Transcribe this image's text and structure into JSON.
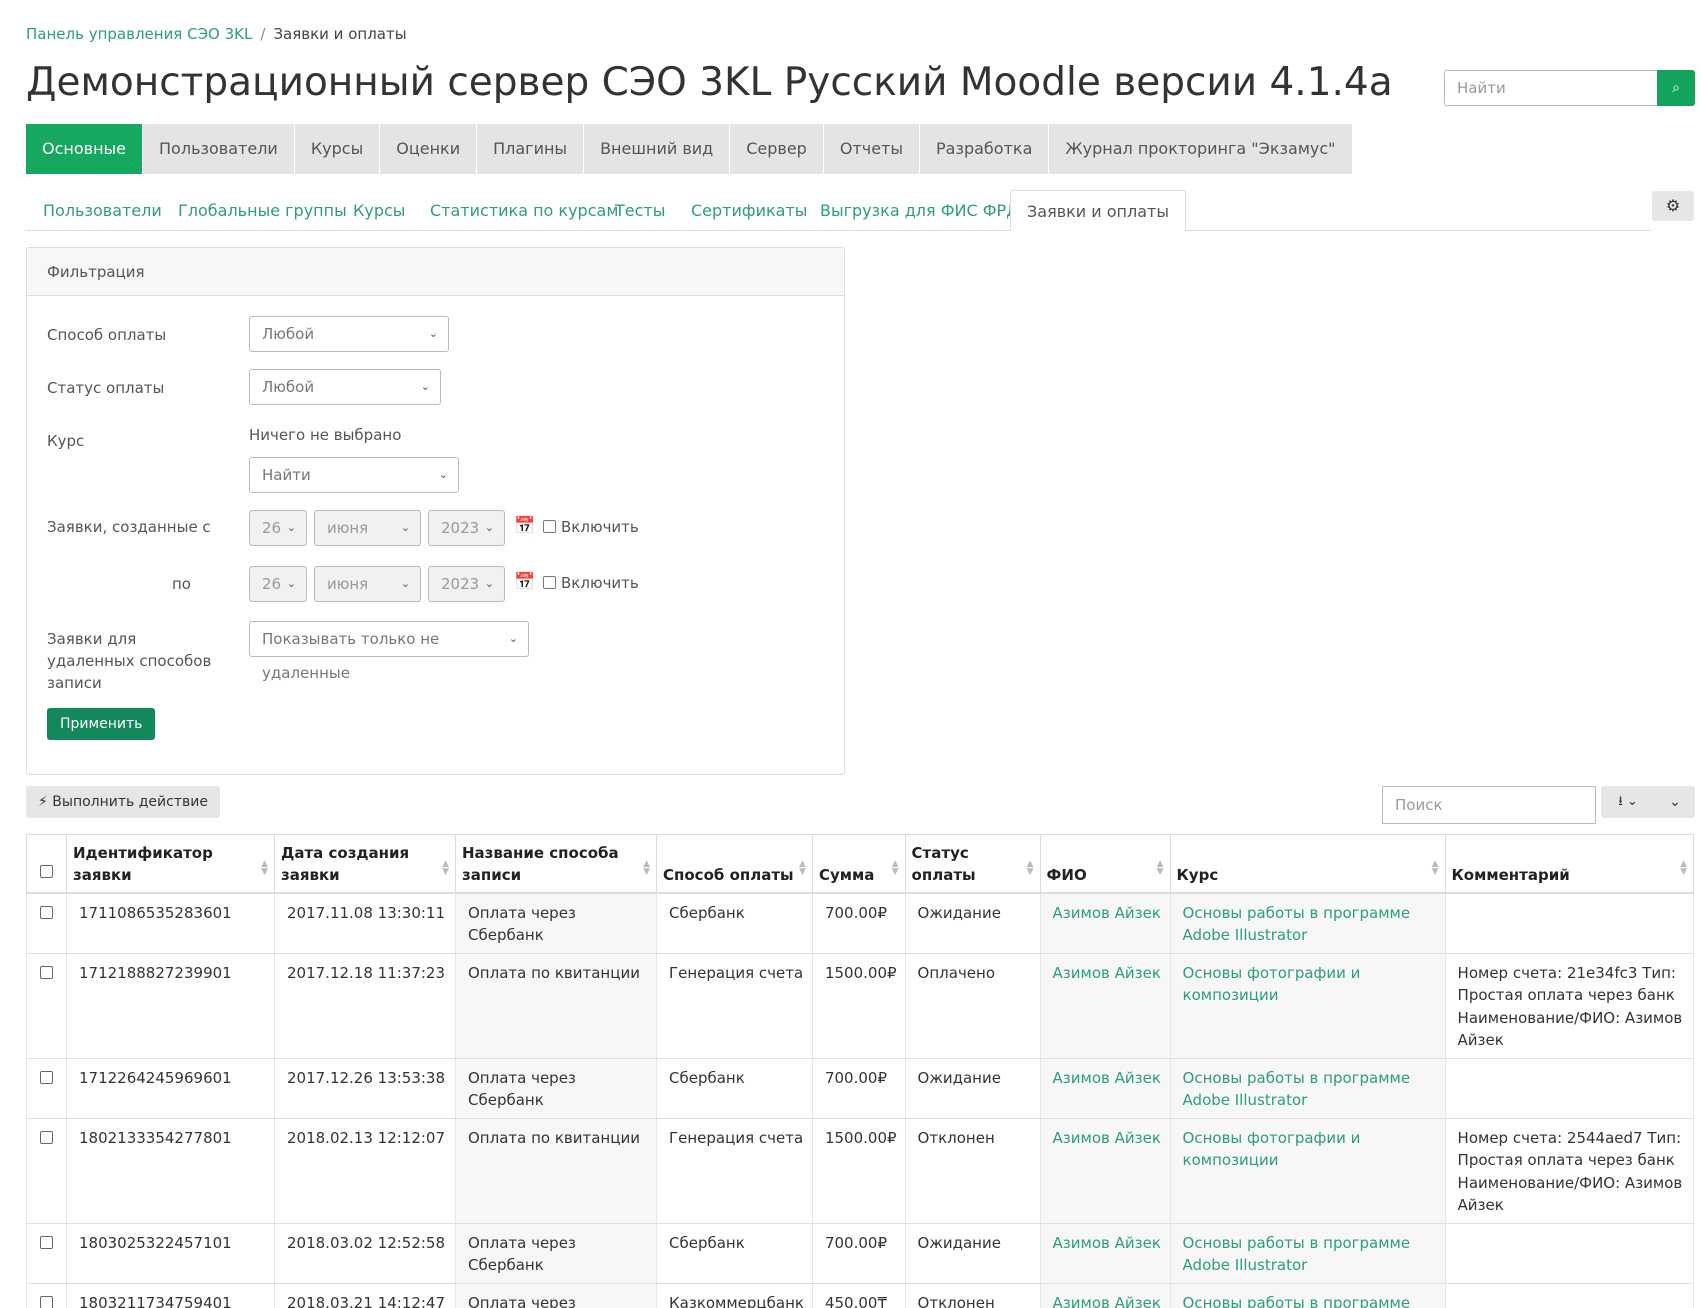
{
  "breadcrumb": {
    "root": "Панель управления СЭО 3KL",
    "current": "Заявки и оплаты"
  },
  "page_title": "Демонстрационный сервер СЭО 3KL Русский Moodle версии 4.1.4a",
  "top_search": {
    "placeholder": "Найти"
  },
  "main_nav": [
    "Основные",
    "Пользователи",
    "Курсы",
    "Оценки",
    "Плагины",
    "Внешний вид",
    "Сервер",
    "Отчеты",
    "Разработка",
    "Журнал прокторинга \"Экзамус\""
  ],
  "sub_tabs": [
    "Пользователи",
    "Глобальные группы",
    "Курсы",
    "Статистика по курсам",
    "Тесты",
    "Сертификаты",
    "Выгрузка для ФИС ФРДО",
    "Заявки и оплаты"
  ],
  "filter": {
    "title": "Фильтрация",
    "payment_method_label": "Способ оплаты",
    "payment_method_value": "Любой",
    "payment_status_label": "Статус оплаты",
    "payment_status_value": "Любой",
    "course_label": "Курс",
    "course_selected": "Ничего не выбрано",
    "course_search": "Найти",
    "created_from_label": "Заявки, созданные с",
    "created_to_label": "по",
    "day": "26",
    "month": "июня",
    "year": "2023",
    "enable_label": "Включить",
    "deleted_label": "Заявки для удаленных способов записи",
    "deleted_value": "Показывать только не удаленные",
    "apply": "Применить"
  },
  "actions": {
    "perform": "Выполнить действие",
    "search_placeholder": "Поиск"
  },
  "table": {
    "headers": [
      "Идентификатор заявки",
      "Дата создания заявки",
      "Название способа записи",
      "Способ оплаты",
      "Сумма",
      "Статус оплаты",
      "ФИО",
      "Курс",
      "Комментарий"
    ],
    "rows": [
      {
        "id": "1711086535283601",
        "date": "2017.11.08 13:30:11",
        "name": "Оплата через Сбербанк",
        "method": "Сбербанк",
        "sum": "700.00₽",
        "status": "Ожидание",
        "fio": "Азимов Айзек",
        "course": "Основы работы в программе Adobe Illustrator",
        "comment": ""
      },
      {
        "id": "1712188827239901",
        "date": "2017.12.18 11:37:23",
        "name": "Оплата по квитанции",
        "method": "Генерация счета",
        "sum": "1500.00₽",
        "status": "Оплачено",
        "fio": "Азимов Айзек",
        "course": "Основы фотографии и композиции",
        "comment": "Номер счета: 21e34fc3 Тип: Простая оплата через банк Наименование/ФИО: Азимов Айзек"
      },
      {
        "id": "1712264245969601",
        "date": "2017.12.26 13:53:38",
        "name": "Оплата через Сбербанк",
        "method": "Сбербанк",
        "sum": "700.00₽",
        "status": "Ожидание",
        "fio": "Азимов Айзек",
        "course": "Основы работы в программе Adobe Illustrator",
        "comment": ""
      },
      {
        "id": "1802133354277801",
        "date": "2018.02.13 12:12:07",
        "name": "Оплата по квитанции",
        "method": "Генерация счета",
        "sum": "1500.00₽",
        "status": "Отклонен",
        "fio": "Азимов Айзек",
        "course": "Основы фотографии и композиции",
        "comment": "Номер счета: 2544aed7 Тип: Простая оплата через банк Наименование/ФИО: Азимов Айзек"
      },
      {
        "id": "1803025322457101",
        "date": "2018.03.02 12:52:58",
        "name": "Оплата через Сбербанк",
        "method": "Сбербанк",
        "sum": "700.00₽",
        "status": "Ожидание",
        "fio": "Азимов Айзек",
        "course": "Основы работы в программе Adobe Illustrator",
        "comment": ""
      },
      {
        "id": "1803211734759401",
        "date": "2018.03.21 14:12:47",
        "name": "Оплата через КазкомБанк",
        "method": "Казкоммерцбанк",
        "sum": "450.00₸",
        "status": "Отклонен",
        "fio": "Азимов Айзек",
        "course": "Основы работы в программе Adobe Illustrator",
        "comment": ""
      }
    ]
  },
  "colors": {
    "accent": "#16a760",
    "link": "#2c9f73"
  }
}
